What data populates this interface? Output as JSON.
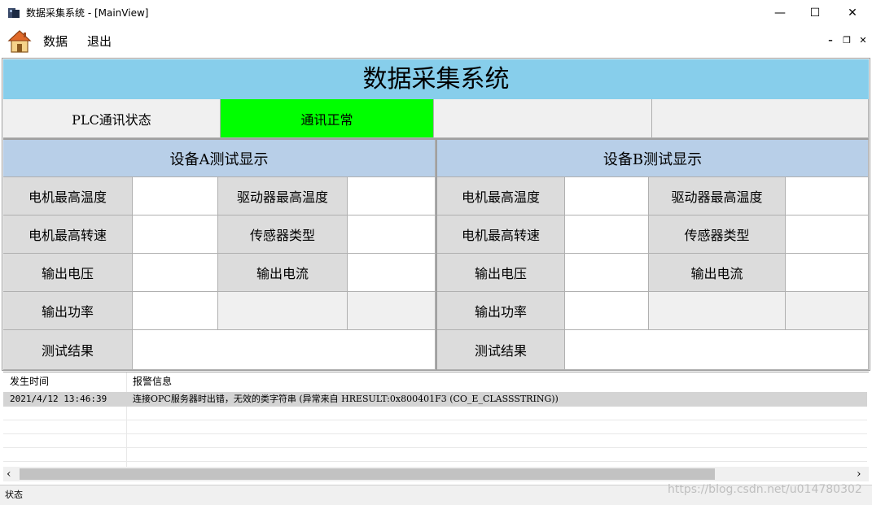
{
  "window": {
    "title": "数据采集系统 - [MainView]",
    "minimize": "—",
    "maximize": "☐",
    "close": "✕"
  },
  "menu": {
    "items": [
      "数据",
      "退出"
    ],
    "mdi_minimize": "–",
    "mdi_restore": "❐",
    "mdi_close": "✕"
  },
  "header": {
    "title": "数据采集系统"
  },
  "status_row": {
    "label": "PLC通讯状态",
    "value": "通讯正常",
    "value_color": "#00ff00"
  },
  "device_a": {
    "title": "设备A测试显示",
    "motor_max_temp": "电机最高温度",
    "driver_max_temp": "驱动器最高温度",
    "motor_max_speed": "电机最高转速",
    "sensor_type": "传感器类型",
    "output_voltage": "输出电压",
    "output_current": "输出电流",
    "output_power": "输出功率",
    "test_result": "测试结果"
  },
  "device_b": {
    "title": "设备B测试显示",
    "motor_max_temp": "电机最高温度",
    "driver_max_temp": "驱动器最高温度",
    "motor_max_speed": "电机最高转速",
    "sensor_type": "传感器类型",
    "output_voltage": "输出电压",
    "output_current": "输出电流",
    "output_power": "输出功率",
    "test_result": "测试结果"
  },
  "alarm_list": {
    "col_time": "发生时间",
    "col_info": "报警信息",
    "rows": [
      {
        "time": "2021/4/12 13:46:39",
        "info": "连接OPC服务器时出错，无效的类字符串 (异常来自 HRESULT:0x800401F3 (CO_E_CLASSSTRING))"
      }
    ],
    "scroll_left": "‹",
    "scroll_right": "›"
  },
  "statusbar": {
    "text": "状态"
  },
  "watermark": "https://blog.csdn.net/u014780302",
  "colors": {
    "header_bg": "#87ceeb",
    "section_bg": "#b8cfe8",
    "ok_green": "#00ff00"
  },
  "icons": {
    "app": "app-icon",
    "home": "home-icon"
  }
}
